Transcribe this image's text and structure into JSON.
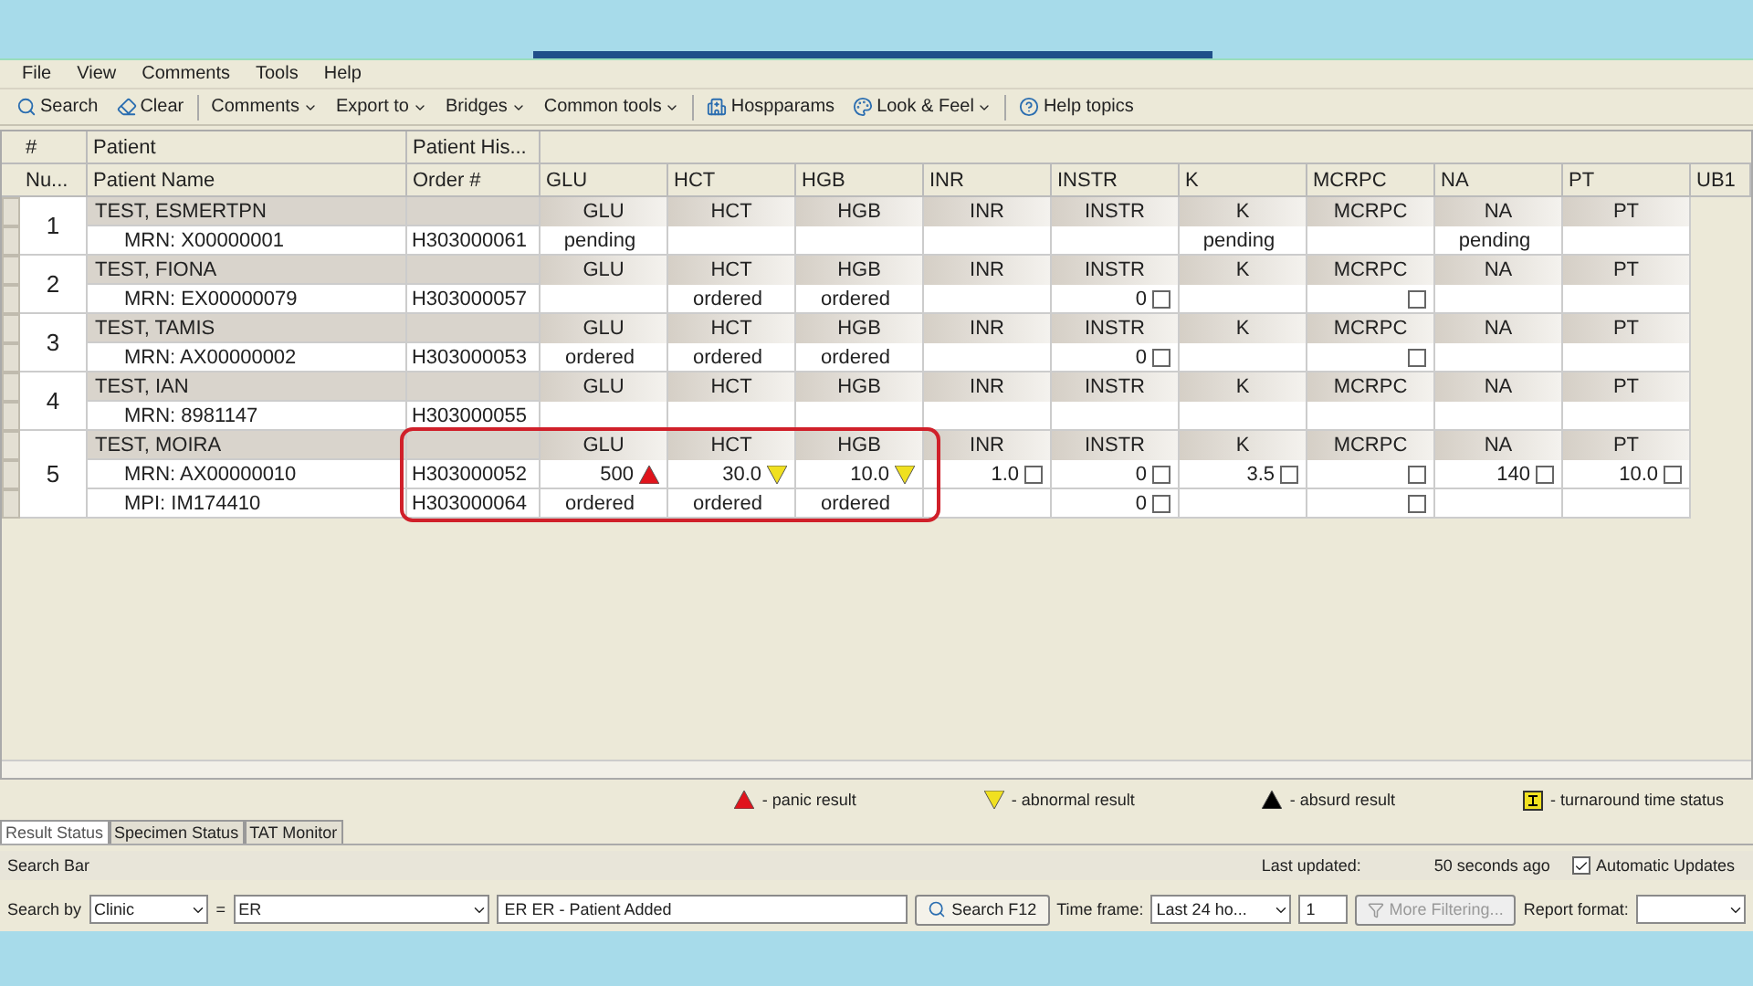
{
  "menu": [
    "File",
    "View",
    "Comments",
    "Tools",
    "Help"
  ],
  "toolbar": [
    {
      "kind": "search",
      "label": "Search",
      "dropdown": false
    },
    {
      "kind": "clear",
      "label": "Clear",
      "dropdown": false
    },
    {
      "kind": "text",
      "label": "Comments",
      "dropdown": true
    },
    {
      "kind": "text",
      "label": "Export to",
      "dropdown": true
    },
    {
      "kind": "text",
      "label": "Bridges",
      "dropdown": true
    },
    {
      "kind": "text",
      "label": "Common tools",
      "dropdown": true
    },
    {
      "kind": "hosp",
      "label": "Hospparams",
      "dropdown": false
    },
    {
      "kind": "look",
      "label": "Look & Feel",
      "dropdown": true
    },
    {
      "kind": "help",
      "label": "Help topics",
      "dropdown": false
    }
  ],
  "grid": {
    "groups": [
      "#",
      "Patient",
      "Patient His..."
    ],
    "columns": [
      "Nu...",
      "Patient Name",
      "Order #",
      "GLU",
      "HCT",
      "HGB",
      "INR",
      "INSTR",
      "K",
      "MCRPC",
      "NA",
      "PT",
      "UB1"
    ],
    "patients": [
      {
        "number": "1",
        "name": "TEST, ESMERTPN",
        "highlighted": false,
        "tests": [
          "GLU",
          "HCT",
          "HGB",
          "INR",
          "INSTR",
          "K",
          "MCRPC",
          "NA",
          "PT"
        ],
        "results": [
          {
            "patient_id": "MRN: X00000001",
            "order": "H303000061",
            "cells": [
              {
                "kind": "text",
                "value": "pending"
              },
              {
                "kind": "empty"
              },
              {
                "kind": "empty"
              },
              {
                "kind": "empty"
              },
              {
                "kind": "empty"
              },
              {
                "kind": "text",
                "value": "pending"
              },
              {
                "kind": "empty"
              },
              {
                "kind": "text",
                "value": "pending"
              },
              {
                "kind": "empty"
              }
            ]
          }
        ]
      },
      {
        "number": "2",
        "name": "TEST, FIONA",
        "highlighted": false,
        "tests": [
          "GLU",
          "HCT",
          "HGB",
          "INR",
          "INSTR",
          "K",
          "MCRPC",
          "NA",
          "PT"
        ],
        "results": [
          {
            "patient_id": "MRN: EX00000079",
            "order": "H303000057",
            "cells": [
              {
                "kind": "empty"
              },
              {
                "kind": "text",
                "value": "ordered"
              },
              {
                "kind": "text",
                "value": "ordered"
              },
              {
                "kind": "empty"
              },
              {
                "kind": "check",
                "value": "0",
                "checked": false
              },
              {
                "kind": "empty"
              },
              {
                "kind": "check",
                "checked": false
              },
              {
                "kind": "empty"
              },
              {
                "kind": "empty"
              }
            ]
          }
        ]
      },
      {
        "number": "3",
        "name": "TEST, TAMIS",
        "highlighted": false,
        "tests": [
          "GLU",
          "HCT",
          "HGB",
          "INR",
          "INSTR",
          "K",
          "MCRPC",
          "NA",
          "PT"
        ],
        "results": [
          {
            "patient_id": "MRN: AX00000002",
            "order": "H303000053",
            "cells": [
              {
                "kind": "text",
                "value": "ordered"
              },
              {
                "kind": "text",
                "value": "ordered"
              },
              {
                "kind": "text",
                "value": "ordered"
              },
              {
                "kind": "empty"
              },
              {
                "kind": "check",
                "value": "0",
                "checked": false
              },
              {
                "kind": "empty"
              },
              {
                "kind": "check",
                "checked": false
              },
              {
                "kind": "empty"
              },
              {
                "kind": "empty"
              }
            ]
          }
        ]
      },
      {
        "number": "4",
        "name": "TEST, IAN",
        "highlighted": false,
        "tests": [
          "GLU",
          "HCT",
          "HGB",
          "INR",
          "INSTR",
          "K",
          "MCRPC",
          "NA",
          "PT"
        ],
        "results": [
          {
            "patient_id": "MRN: 8981147",
            "order": "H303000055",
            "cells": [
              {
                "kind": "empty"
              },
              {
                "kind": "empty"
              },
              {
                "kind": "empty"
              },
              {
                "kind": "empty"
              },
              {
                "kind": "empty"
              },
              {
                "kind": "empty"
              },
              {
                "kind": "empty"
              },
              {
                "kind": "empty"
              },
              {
                "kind": "empty"
              }
            ]
          }
        ]
      },
      {
        "number": "5",
        "name": "TEST, MOIRA",
        "highlighted": true,
        "tests": [
          "GLU",
          "HCT",
          "HGB",
          "INR",
          "INSTR",
          "K",
          "MCRPC",
          "NA",
          "PT"
        ],
        "results": [
          {
            "patient_id": "MRN: AX00000010",
            "order": "H303000052",
            "cells": [
              {
                "kind": "panic",
                "value": "500"
              },
              {
                "kind": "abnormal",
                "value": "30.0"
              },
              {
                "kind": "abnormal",
                "value": "10.0"
              },
              {
                "kind": "check",
                "value": "1.0",
                "checked": false
              },
              {
                "kind": "check",
                "value": "0",
                "checked": false
              },
              {
                "kind": "check",
                "value": "3.5",
                "checked": false
              },
              {
                "kind": "check",
                "checked": false
              },
              {
                "kind": "check",
                "value": "140",
                "checked": false
              },
              {
                "kind": "check",
                "value": "10.0",
                "checked": false
              }
            ]
          },
          {
            "patient_id": "MPI: IM174410",
            "order": "H303000064",
            "cells": [
              {
                "kind": "text",
                "value": "ordered"
              },
              {
                "kind": "text",
                "value": "ordered"
              },
              {
                "kind": "text",
                "value": "ordered"
              },
              {
                "kind": "empty"
              },
              {
                "kind": "check",
                "value": "0",
                "checked": false
              },
              {
                "kind": "empty"
              },
              {
                "kind": "check",
                "checked": false
              },
              {
                "kind": "empty"
              },
              {
                "kind": "empty"
              }
            ]
          }
        ]
      }
    ]
  },
  "legend": [
    {
      "kind": "panic",
      "label": "- panic result"
    },
    {
      "kind": "abnormal",
      "label": "- abnormal result"
    },
    {
      "kind": "absurd",
      "label": "- absurd result"
    },
    {
      "kind": "tat",
      "label": "- turnaround time status"
    }
  ],
  "tabs": [
    {
      "label": "Result Status",
      "selected": true
    },
    {
      "label": "Specimen Status",
      "selected": false
    },
    {
      "label": "TAT Monitor",
      "selected": false
    }
  ],
  "search_bar": {
    "title": "Search Bar",
    "last_updated_label": "Last updated:",
    "last_updated": "50 seconds ago",
    "auto_update": {
      "label": "Automatic Updates",
      "checked": true
    },
    "search_by_label": "Search by",
    "search_by": "Clinic",
    "operator": "=",
    "clinic": "ER",
    "filter": "ER ER - Patient Added",
    "search_button": "Search F12",
    "time_frame_label": "Time frame:",
    "time_frame": "Last 24 ho...",
    "count": "1",
    "more_filtering": {
      "label": "More Filtering...",
      "disabled": true
    },
    "report_format_label": "Report format:"
  }
}
